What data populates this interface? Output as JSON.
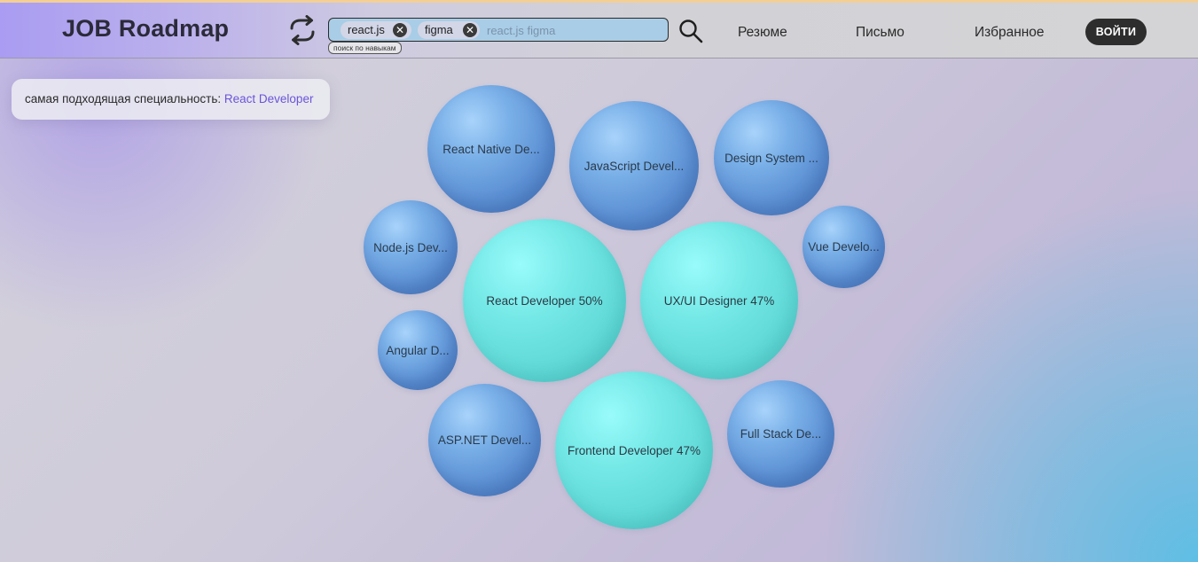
{
  "header": {
    "logo": "JOB Roadmap",
    "search": {
      "chips": [
        "react.js",
        "figma"
      ],
      "placeholder": "react.js figma",
      "hint": "поиск по навыкам"
    },
    "nav": [
      "Резюме",
      "Письмо",
      "Избранное"
    ],
    "login": "ВОЙТИ"
  },
  "best_match": {
    "label": "самая подходящая специальность:",
    "specialty": "React Developer"
  },
  "bubbles": [
    {
      "label": "React Native De...",
      "kind": "blue"
    },
    {
      "label": "JavaScript Devel...",
      "kind": "blue"
    },
    {
      "label": "Design System ...",
      "kind": "blue"
    },
    {
      "label": "Node.js Dev...",
      "kind": "blue"
    },
    {
      "label": "Vue Develo...",
      "kind": "blue"
    },
    {
      "label": "React Developer 50%",
      "kind": "teal"
    },
    {
      "label": "UX/UI Designer 47%",
      "kind": "teal"
    },
    {
      "label": "Angular D...",
      "kind": "blue"
    },
    {
      "label": "ASP.NET Devel...",
      "kind": "blue"
    },
    {
      "label": "Frontend Developer 47%",
      "kind": "teal"
    },
    {
      "label": "Full Stack De...",
      "kind": "blue"
    }
  ],
  "colors": {
    "accent": "#6a55d8",
    "bubble_blue": "#5b8fd3",
    "bubble_teal": "#5fd8d6",
    "login_bg": "#2d2d2d"
  }
}
